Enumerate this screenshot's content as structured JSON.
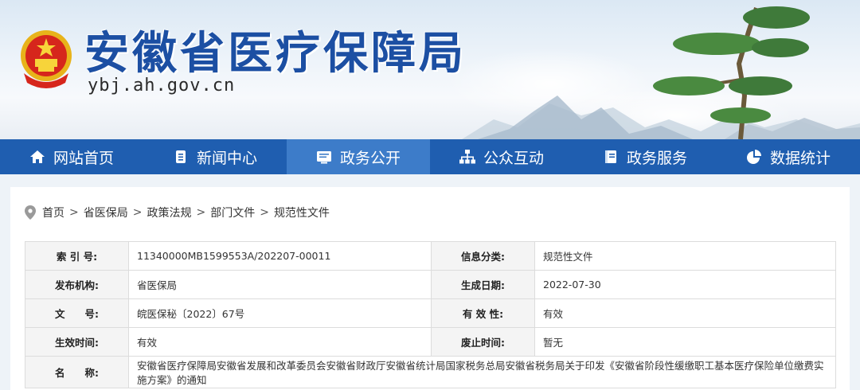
{
  "header": {
    "title": "安徽省医疗保障局",
    "domain": "ybj.ah.gov.cn",
    "brand_color": "#1c4fa3"
  },
  "nav": {
    "color": "#1f5eb0",
    "active_color": "#3d7cc9",
    "items": [
      {
        "label": "网站首页",
        "icon": "home-icon",
        "active": false
      },
      {
        "label": "新闻中心",
        "icon": "document-icon",
        "active": false
      },
      {
        "label": "政务公开",
        "icon": "monitor-icon",
        "active": true
      },
      {
        "label": "公众互动",
        "icon": "network-icon",
        "active": false
      },
      {
        "label": "政务服务",
        "icon": "book-icon",
        "active": false
      },
      {
        "label": "数据统计",
        "icon": "pie-chart-icon",
        "active": false
      }
    ]
  },
  "breadcrumb": {
    "icon": "location-pin-icon",
    "separator": ">",
    "items": [
      "首页",
      "省医保局",
      "政策法规",
      "部门文件",
      "规范性文件"
    ]
  },
  "meta": {
    "rows": [
      {
        "l1": "索 引 号:",
        "v1": "11340000MB1599553A/202207-00011",
        "l2": "信息分类:",
        "v2": "规范性文件"
      },
      {
        "l1": "发布机构:",
        "v1": "省医保局",
        "l2": "生成日期:",
        "v2": "2022-07-30"
      },
      {
        "l1": "文　　号:",
        "v1": "皖医保秘〔2022〕67号",
        "l2": "有 效 性:",
        "v2": "有效"
      },
      {
        "l1": "生效时间:",
        "v1": "有效",
        "l2": "废止时间:",
        "v2": "暂无"
      }
    ],
    "name_label": "名　　称:",
    "name_value": "安徽省医疗保障局安徽省发展和改革委员会安徽省财政厅安徽省统计局国家税务总局安徽省税务局关于印发《安徽省阶段性缓缴职工基本医疗保险单位缴费实施方案》的通知"
  }
}
